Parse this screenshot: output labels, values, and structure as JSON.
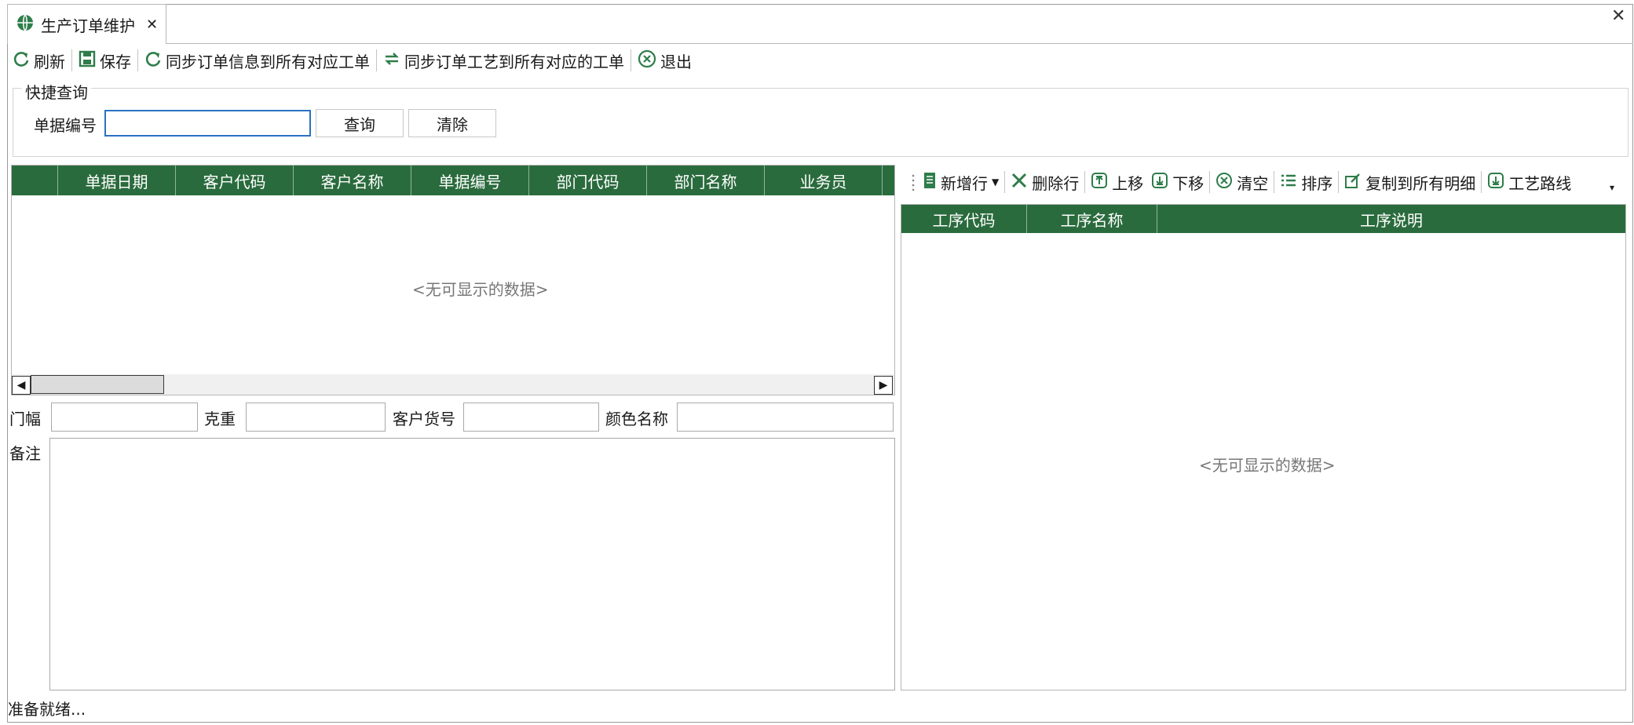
{
  "tab": {
    "title": "生产订单维护",
    "close": "✕"
  },
  "window_close": "✕",
  "toolbar": [
    {
      "label": "刷新",
      "icon": "refresh-icon"
    },
    {
      "label": "保存",
      "icon": "save-icon"
    },
    {
      "label": "同步订单信息到所有对应工单",
      "icon": "refresh-icon"
    },
    {
      "label": "同步订单工艺到所有对应的工单",
      "icon": "sync-icon"
    },
    {
      "label": "退出",
      "icon": "exit-icon"
    }
  ],
  "quick_query": {
    "title": "快捷查询",
    "doc_no_label": "单据编号",
    "doc_no_value": "",
    "query_button": "查询",
    "clear_button": "清除"
  },
  "order_grid": {
    "columns": [
      "",
      "单据日期",
      "客户代码",
      "客户名称",
      "单据编号",
      "部门代码",
      "部门名称",
      "业务员"
    ],
    "empty": "<无可显示的数据>"
  },
  "form": {
    "width_label": "门幅",
    "weight_label": "克重",
    "cust_item_label": "客户货号",
    "color_label": "颜色名称",
    "remark_label": "备注"
  },
  "detail_toolbar": [
    {
      "label": "新增行",
      "icon": "new-row-icon"
    },
    {
      "label": "删除行",
      "icon": "delete-icon"
    },
    {
      "label": "上移",
      "icon": "move-up-icon"
    },
    {
      "label": "下移",
      "icon": "move-down-icon"
    },
    {
      "label": "清空",
      "icon": "clear-icon"
    },
    {
      "label": "排序",
      "icon": "sort-icon"
    },
    {
      "label": "复制到所有明细",
      "icon": "copy-icon"
    },
    {
      "label": "工艺路线",
      "icon": "route-icon"
    }
  ],
  "process_grid": {
    "columns": [
      "工序代码",
      "工序名称",
      "工序说明"
    ],
    "empty": "<无可显示的数据>"
  },
  "status": "准备就绪...",
  "colors": {
    "header_green": "#2a6b3d",
    "icon_green": "#2e7d4a",
    "focus_blue": "#2a72c2"
  }
}
